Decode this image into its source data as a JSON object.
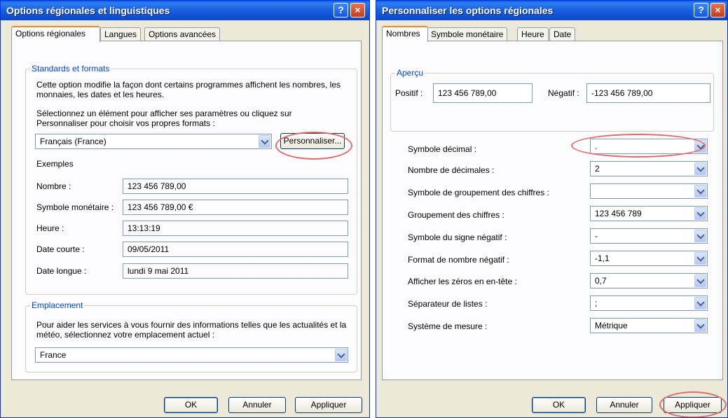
{
  "left_dialog": {
    "title": "Options régionales et linguistiques",
    "help_glyph": "?",
    "close_glyph": "×",
    "tabs": [
      "Options régionales",
      "Langues",
      "Options avancées"
    ],
    "standards": {
      "legend": "Standards et formats",
      "desc": "Cette option modifie la façon dont certains programmes affichent les nombres, les monnaies, les dates et les heures.",
      "select_hint": "Sélectionnez un élément pour afficher ses paramètres ou cliquez sur Personnaliser pour choisir vos propres formats :",
      "locale": "Français (France)",
      "customize_button": "Personnaliser...",
      "examples_label": "Exemples",
      "examples": [
        {
          "label": "Nombre :",
          "value": "123 456 789,00"
        },
        {
          "label": "Symbole monétaire :",
          "value": "123 456 789,00 €"
        },
        {
          "label": "Heure :",
          "value": "13:13:19"
        },
        {
          "label": "Date courte :",
          "value": "09/05/2011"
        },
        {
          "label": "Date longue :",
          "value": "lundi 9 mai 2011"
        }
      ]
    },
    "location": {
      "legend": "Emplacement",
      "desc": "Pour aider les services à vous fournir des informations telles que les actualités et la météo, sélectionnez votre emplacement actuel :",
      "value": "France"
    },
    "buttons": {
      "ok": "OK",
      "cancel": "Annuler",
      "apply": "Appliquer"
    }
  },
  "right_dialog": {
    "title": "Personnaliser les options régionales",
    "help_glyph": "?",
    "close_glyph": "×",
    "tabs": [
      "Nombres",
      "Symbole monétaire",
      "Heure",
      "Date"
    ],
    "preview": {
      "legend": "Aperçu",
      "positive_label": "Positif :",
      "positive_value": "123 456 789,00",
      "negative_label": "Négatif :",
      "negative_value": "-123 456 789,00"
    },
    "settings": [
      {
        "label": "Symbole décimal :",
        "value": "."
      },
      {
        "label": "Nombre de décimales :",
        "value": "2"
      },
      {
        "label": "Symbole de groupement des chiffres :",
        "value": ""
      },
      {
        "label": "Groupement des chiffres :",
        "value": "123 456 789"
      },
      {
        "label": "Symbole du signe négatif :",
        "value": "-"
      },
      {
        "label": "Format de nombre négatif :",
        "value": "-1,1"
      },
      {
        "label": "Afficher les zéros en en-tête :",
        "value": "0,7"
      },
      {
        "label": "Séparateur de listes :",
        "value": ";"
      },
      {
        "label": "Système de mesure :",
        "value": "Métrique"
      }
    ],
    "buttons": {
      "ok": "OK",
      "cancel": "Annuler",
      "apply": "Appliquer"
    }
  },
  "colors": {
    "highlight_ring": "#e06a6a",
    "legend_text": "#0046d5",
    "titlebar": "#0b47c7"
  }
}
